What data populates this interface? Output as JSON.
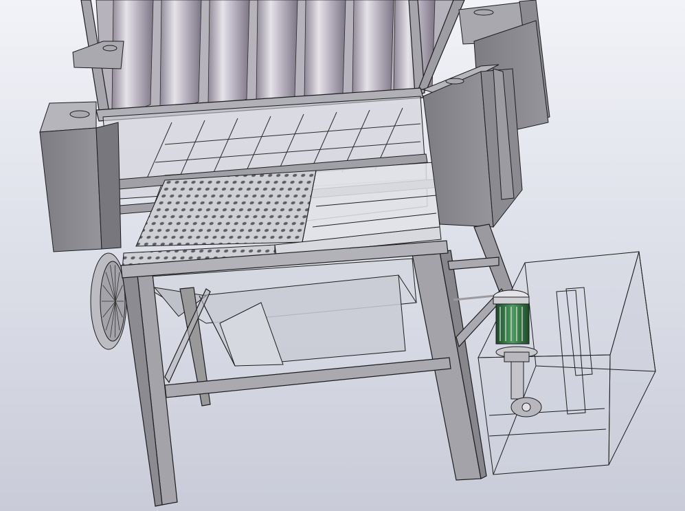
{
  "viewport": {
    "background_top": "#f2f3f8",
    "background_bottom": "#c9ccd8"
  },
  "model": {
    "components": [
      "tube-bank",
      "upper-frame",
      "header-box-left",
      "header-box-right",
      "grid-rack",
      "perforated-tray",
      "hopper",
      "fan-inlet",
      "support-legs",
      "water-tank",
      "pump-motor"
    ],
    "colors": {
      "steel": "#9a9aa0",
      "steel_dark": "#6f6f75",
      "edge": "#1c1c1c",
      "tube_light": "#d9d6df",
      "tube_dark": "#8e8796",
      "glass": "#d7dae3",
      "motor_green": "#2f6b3c"
    }
  }
}
